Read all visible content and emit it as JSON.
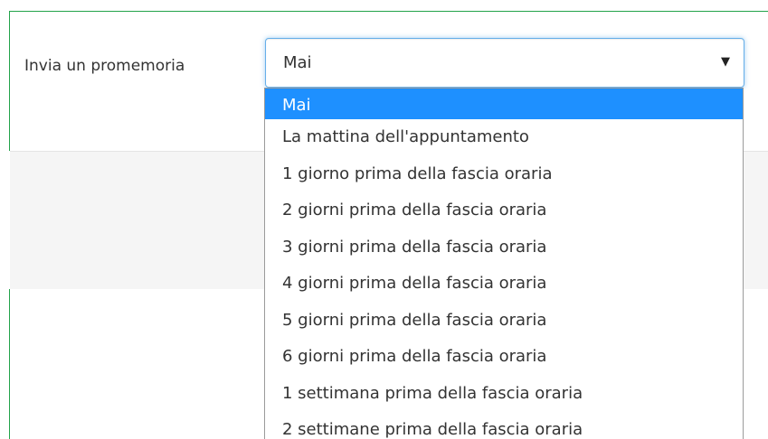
{
  "form": {
    "label": "Invia un promemoria",
    "select": {
      "value": "Mai",
      "arrow_icon": "caret-down-icon"
    }
  },
  "dropdown": {
    "options": [
      "Mai",
      "La mattina dell'appuntamento",
      "1 giorno prima della fascia oraria",
      "2 giorni prima della fascia oraria",
      "3 giorni prima della fascia oraria",
      "4 giorni prima della fascia oraria",
      "5 giorni prima della fascia oraria",
      "6 giorni prima della fascia oraria",
      "1 settimana prima della fascia oraria",
      "2 settimane prima della fascia oraria"
    ],
    "selected_index": 0
  },
  "colors": {
    "panel_border": "#22a34a",
    "selected_option_bg": "#1e90ff",
    "focus_border": "#66afe9"
  }
}
